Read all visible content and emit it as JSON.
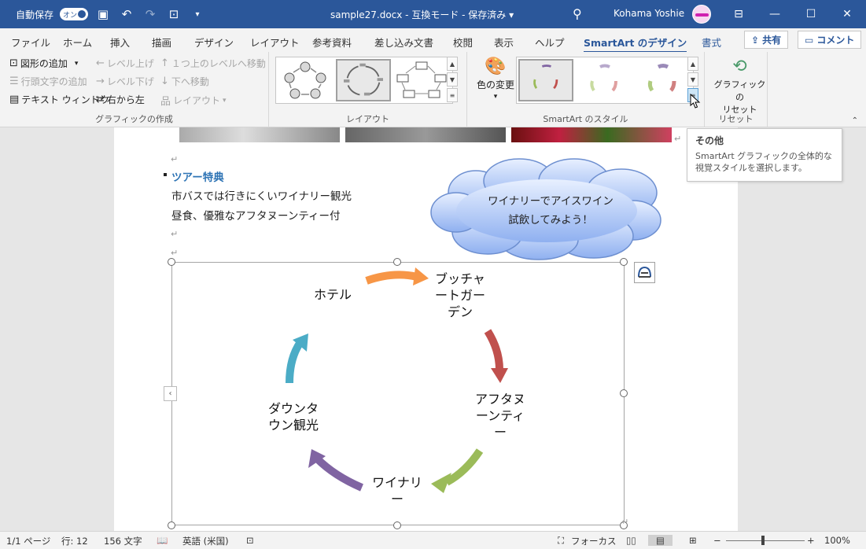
{
  "titlebar": {
    "autosave_label": "自動保存",
    "autosave_state": "オン",
    "document_title": "sample27.docx  -  互換モード  -  保存済み  ▾",
    "user_name": "Kohama Yoshie",
    "qat_icons": [
      "save-icon",
      "undo-icon",
      "redo-icon",
      "touch-mode-icon",
      "customize-qat-icon"
    ]
  },
  "tabs": [
    {
      "label": "ファイル"
    },
    {
      "label": "ホーム"
    },
    {
      "label": "挿入"
    },
    {
      "label": "描画"
    },
    {
      "label": "デザイン"
    },
    {
      "label": "レイアウト"
    },
    {
      "label": "参考資料"
    },
    {
      "label": "差し込み文書"
    },
    {
      "label": "校閲"
    },
    {
      "label": "表示"
    },
    {
      "label": "ヘルプ"
    },
    {
      "label": "SmartArt のデザイン"
    },
    {
      "label": "書式"
    }
  ],
  "tab_actions": {
    "share": "共有",
    "comment": "コメント"
  },
  "ribbon": {
    "create_graphic": {
      "label": "グラフィックの作成",
      "add_shape": "図形の追加",
      "add_bullet": "行頭文字の追加",
      "text_pane": "テキスト ウィンドウ",
      "promote": "レベル上げ",
      "demote": "レベル下げ",
      "right_to_left": "右から左",
      "move_up": "１つ上のレベルへ移動",
      "move_down": "下へ移動",
      "layout": "レイアウト"
    },
    "layouts": {
      "label": "レイアウト"
    },
    "styles": {
      "label": "SmartArt のスタイル",
      "change_colors": "色の変更"
    },
    "reset": {
      "label": "リセット",
      "reset_graphic": "グラフィックの\nリセット"
    }
  },
  "tooltip": {
    "title": "その他",
    "description": "SmartArt グラフィックの全体的な視覚スタイルを選択します。"
  },
  "document": {
    "heading": "ツアー特典",
    "line1": "市バスでは行きにくいワイナリー観光",
    "line2": "昼食、優雅なアフタヌーンティー付",
    "callout": "ワイナリーでアイスワイン\n試飲してみよう！"
  },
  "smartart": {
    "nodes": [
      {
        "text": "ホテル",
        "color": "#f79646"
      },
      {
        "text": "ブッチャ\nートガー\nデン",
        "color": "#c0504d"
      },
      {
        "text": "アフタヌ\nーンティ\nー",
        "color": "#9bbb59"
      },
      {
        "text": "ワイナリ\nー",
        "color": "#8064a2"
      },
      {
        "text": "ダウンタ\nウン観光",
        "color": "#4bacc6"
      }
    ]
  },
  "statusbar": {
    "page": "1/1 ページ",
    "line": "行: 12",
    "words": "156 文字",
    "language": "英語 (米国)",
    "focus": "フォーカス",
    "zoom": "100%"
  }
}
